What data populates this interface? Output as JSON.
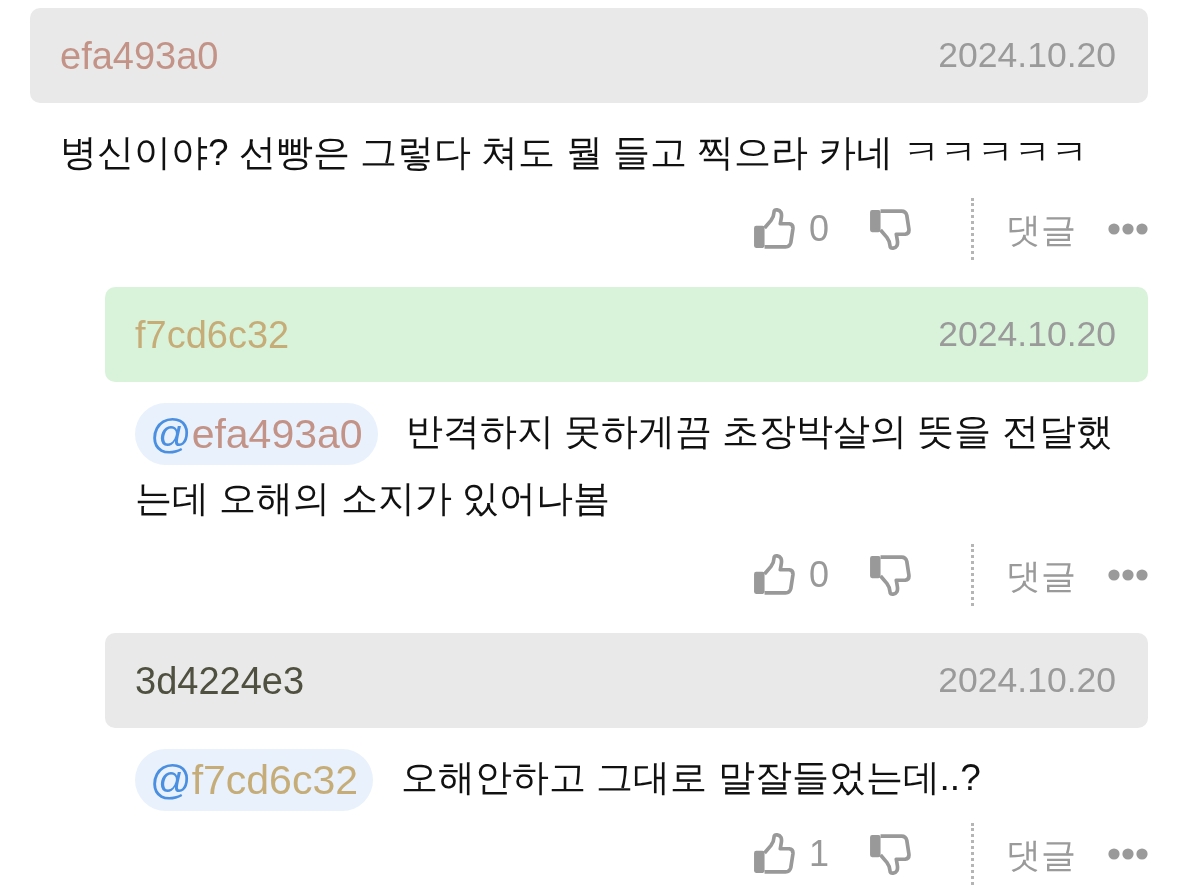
{
  "comments": [
    {
      "author": "efa493a0",
      "color": "#c39387",
      "date": "2024.10.20",
      "highlighted": false,
      "text": "병신이야? 선빵은 그렇다 쳐도 뭘 들고 찍으라 카네 ㅋㅋㅋㅋㅋ",
      "likes": "0",
      "reply_label": "댓글",
      "replies": [
        {
          "author": "f7cd6c32",
          "color": "#c6ad78",
          "date": "2024.10.20",
          "highlighted": true,
          "mention": {
            "at": "@",
            "name": "efa493a0",
            "color": "#c39387"
          },
          "text": "반격하지 못하게끔 초장박살의 뜻을 전달했는데 오해의 소지가 있어나봄",
          "likes": "0",
          "reply_label": "댓글"
        },
        {
          "author": "3d4224e3",
          "color": "#505040",
          "date": "2024.10.20",
          "highlighted": false,
          "mention": {
            "at": "@",
            "name": "f7cd6c32",
            "color": "#c6ad78"
          },
          "text": "오해안하고 그대로 말잘들었는데..?",
          "likes": "1",
          "reply_label": "댓글"
        }
      ]
    }
  ]
}
